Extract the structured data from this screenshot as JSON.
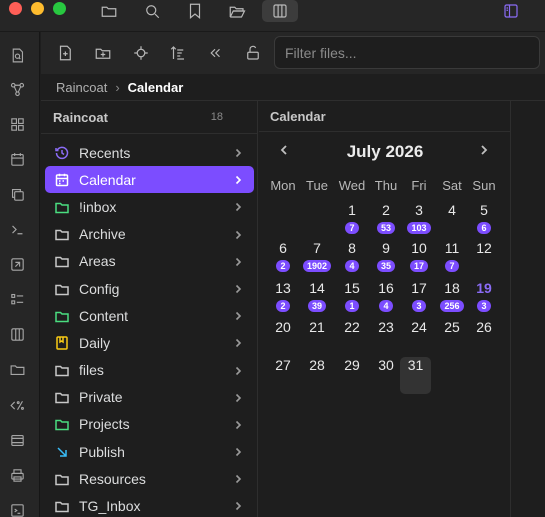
{
  "titlebar": {
    "icons": [
      "folder-icon",
      "search-icon",
      "bookmark-icon",
      "folder-open-icon",
      "columns-icon",
      "sidebar-toggle-icon"
    ]
  },
  "ribbon": {
    "icons": [
      "search-doc-icon",
      "graph-icon",
      "blocks-icon",
      "calendar-icon",
      "copy-icon",
      "terminal-icon",
      "shortcut-icon",
      "list-icon",
      "columns-icon",
      "folder-icon",
      "code-percent-icon",
      "window-icon",
      "print-icon",
      "terminal-doc-icon"
    ]
  },
  "nav_toolbar": {
    "filter_placeholder": "Filter files..."
  },
  "breadcrumb": {
    "root": "Raincoat",
    "separator": "›",
    "current": "Calendar"
  },
  "file_pane": {
    "title": "Raincoat",
    "count": "18",
    "items": [
      {
        "label": "Recents",
        "icon": "clock-icon",
        "color": "#8b6cf6"
      },
      {
        "label": "Calendar",
        "icon": "calendar-icon",
        "color": "#ffffff",
        "selected": true
      },
      {
        "label": "!inbox",
        "icon": "folder-icon",
        "color": "#4ade80"
      },
      {
        "label": "Archive",
        "icon": "folder-icon",
        "color": "#c8c8c8"
      },
      {
        "label": "Areas",
        "icon": "folder-icon",
        "color": "#c8c8c8"
      },
      {
        "label": "Config",
        "icon": "folder-icon",
        "color": "#c8c8c8"
      },
      {
        "label": "Content",
        "icon": "folder-icon",
        "color": "#4ade80"
      },
      {
        "label": "Daily",
        "icon": "daily-note-icon",
        "color": "#facc15"
      },
      {
        "label": "files",
        "icon": "folder-icon",
        "color": "#c8c8c8"
      },
      {
        "label": "Private",
        "icon": "folder-icon",
        "color": "#c8c8c8"
      },
      {
        "label": "Projects",
        "icon": "folder-icon",
        "color": "#4ade80"
      },
      {
        "label": "Publish",
        "icon": "arrow-down-right-icon",
        "color": "#38bdf8"
      },
      {
        "label": "Resources",
        "icon": "folder-icon",
        "color": "#c8c8c8"
      },
      {
        "label": "TG_Inbox",
        "icon": "folder-icon",
        "color": "#c8c8c8"
      }
    ]
  },
  "calendar": {
    "pane_title": "Calendar",
    "month_title": "July 2026",
    "weekdays": [
      "Mon",
      "Tue",
      "Wed",
      "Thu",
      "Fri",
      "Sat",
      "Sun"
    ],
    "accent": "#7c4dff",
    "weeks": [
      [
        null,
        null,
        {
          "d": "1",
          "c": "7"
        },
        {
          "d": "2",
          "c": "53"
        },
        {
          "d": "3",
          "c": "103"
        },
        {
          "d": "4"
        },
        {
          "d": "5",
          "c": "6"
        }
      ],
      [
        {
          "d": "6",
          "c": "2"
        },
        {
          "d": "7",
          "c": "1902"
        },
        {
          "d": "8",
          "c": "4"
        },
        {
          "d": "9",
          "c": "35"
        },
        {
          "d": "10",
          "c": "17"
        },
        {
          "d": "11",
          "c": "7"
        },
        {
          "d": "12"
        }
      ],
      [
        {
          "d": "13",
          "c": "2"
        },
        {
          "d": "14",
          "c": "39"
        },
        {
          "d": "15",
          "c": "1"
        },
        {
          "d": "16",
          "c": "4"
        },
        {
          "d": "17",
          "c": "3"
        },
        {
          "d": "18",
          "c": "256"
        },
        {
          "d": "19",
          "c": "3",
          "today": true
        }
      ],
      [
        {
          "d": "20"
        },
        {
          "d": "21"
        },
        {
          "d": "22"
        },
        {
          "d": "23"
        },
        {
          "d": "24"
        },
        {
          "d": "25"
        },
        {
          "d": "26"
        }
      ],
      [
        {
          "d": "27"
        },
        {
          "d": "28"
        },
        {
          "d": "29"
        },
        {
          "d": "30"
        },
        {
          "d": "31",
          "selected": true
        },
        null,
        null
      ]
    ]
  }
}
